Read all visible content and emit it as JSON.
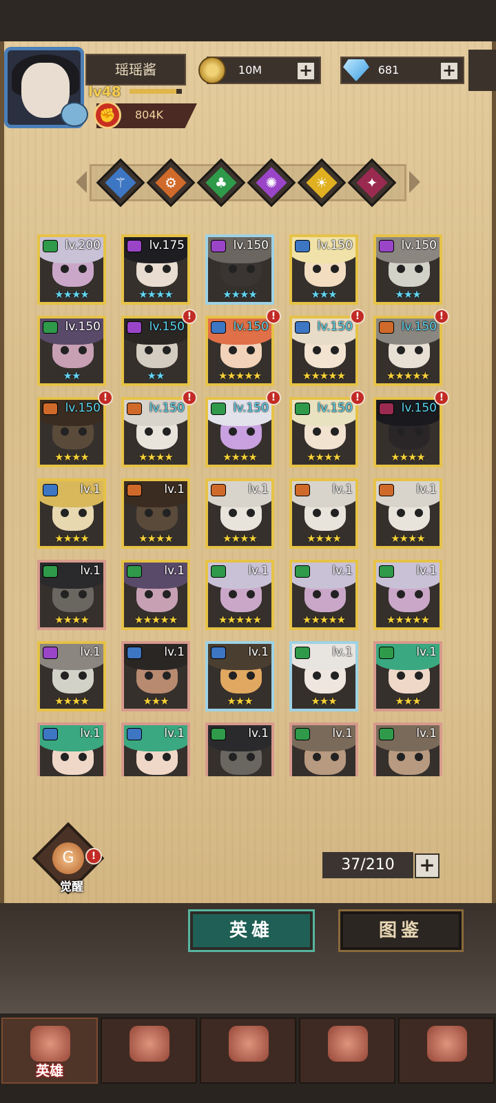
{
  "player": {
    "name": "瑶瑶酱",
    "level": "lv48",
    "xp_fraction": 0.9,
    "power": "804K"
  },
  "resources": {
    "gold": "10M",
    "gems": "681"
  },
  "factions": [
    {
      "icon": "guardian-faction-icon",
      "color": "#3d76c2"
    },
    {
      "icon": "gear-faction-icon",
      "color": "#d06a2a"
    },
    {
      "icon": "clover-faction-icon",
      "color": "#2f9a4a"
    },
    {
      "icon": "arcane-faction-icon",
      "color": "#9a45c8"
    },
    {
      "icon": "sun-faction-icon",
      "color": "#e0b020"
    },
    {
      "icon": "demon-faction-icon",
      "color": "#9a2a50"
    }
  ],
  "heroes": [
    {
      "lv": "lv.200",
      "stars": "★★★★",
      "star": "sky",
      "frame": "gold",
      "cls": "#2f9a4a",
      "hair": "#c9c2d6",
      "skin": "#caa7c8",
      "alert": false,
      "cyan": false
    },
    {
      "lv": "lv.175",
      "stars": "★★★★",
      "star": "sky",
      "frame": "gold",
      "cls": "#9a45c8",
      "hair": "#1e1e22",
      "skin": "#e8ddd0",
      "alert": false,
      "cyan": false
    },
    {
      "lv": "lv.150",
      "stars": "★★★★",
      "star": "sky",
      "frame": "blue",
      "cls": "#9a45c8",
      "hair": "#6b6660",
      "skin": "#3a3432",
      "alert": false,
      "cyan": false
    },
    {
      "lv": "lv.150",
      "stars": "★★★",
      "star": "sky",
      "frame": "gold",
      "cls": "#3d76c2",
      "hair": "#f0e2a8",
      "skin": "#f2ddc0",
      "alert": false,
      "cyan": false
    },
    {
      "lv": "lv.150",
      "stars": "★★★",
      "star": "sky",
      "frame": "gold",
      "cls": "#9a45c8",
      "hair": "#8c8680",
      "skin": "#d2d2c8",
      "alert": false,
      "cyan": false
    },
    {
      "lv": "lv.150",
      "stars": "★★",
      "star": "sky",
      "frame": "gold",
      "cls": "#2f9a4a",
      "hair": "#5a4a6a",
      "skin": "#c7a0b4",
      "alert": false,
      "cyan": false
    },
    {
      "lv": "lv.150",
      "stars": "★★",
      "star": "sky",
      "frame": "gold",
      "cls": "#9a45c8",
      "hair": "#2a2624",
      "skin": "#d4ccc0",
      "alert": true,
      "cyan": true
    },
    {
      "lv": "lv.150",
      "stars": "★★★★★",
      "star": "gold",
      "frame": "gold",
      "cls": "#3d76c2",
      "hair": "#e07048",
      "skin": "#f2d2b8",
      "alert": true,
      "cyan": true
    },
    {
      "lv": "lv.150",
      "stars": "★★★★★",
      "star": "gold",
      "frame": "gold",
      "cls": "#3d76c2",
      "hair": "#e6dcc8",
      "skin": "#f2e4d0",
      "alert": true,
      "cyan": true
    },
    {
      "lv": "lv.150",
      "stars": "★★★★★",
      "star": "gold",
      "frame": "gold",
      "cls": "#d06a2a",
      "hair": "#8a8680",
      "skin": "#e8e0d4",
      "alert": true,
      "cyan": true
    },
    {
      "lv": "lv.150",
      "stars": "★★★★",
      "star": "gold",
      "frame": "gold",
      "cls": "#d06a2a",
      "hair": "#3a2c20",
      "skin": "#5a4a3a",
      "alert": true,
      "cyan": true
    },
    {
      "lv": "lv.150",
      "stars": "★★★★",
      "star": "gold",
      "frame": "gold",
      "cls": "#d06a2a",
      "hair": "#d8d4cc",
      "skin": "#e8e4dc",
      "alert": true,
      "cyan": true
    },
    {
      "lv": "lv.150",
      "stars": "★★★★",
      "star": "gold",
      "frame": "gold",
      "cls": "#2f9a4a",
      "hair": "#e2e2ea",
      "skin": "#c9a0e0",
      "alert": true,
      "cyan": true
    },
    {
      "lv": "lv.150",
      "stars": "★★★★",
      "star": "gold",
      "frame": "gold",
      "cls": "#2f9a4a",
      "hair": "#e8e2c0",
      "skin": "#f2e2d0",
      "alert": true,
      "cyan": true
    },
    {
      "lv": "lv.150",
      "stars": "★★★★",
      "star": "gold",
      "frame": "gold",
      "cls": "#9a2a50",
      "hair": "#1a1a1e",
      "skin": "#2a2628",
      "alert": true,
      "cyan": true
    },
    {
      "lv": "lv.1",
      "stars": "★★★★",
      "star": "gold",
      "frame": "gold",
      "cls": "#3d76c2",
      "hair": "#d8b85a",
      "skin": "#e8d8b0",
      "alert": false,
      "cyan": false
    },
    {
      "lv": "lv.1",
      "stars": "★★★★",
      "star": "gold",
      "frame": "gold",
      "cls": "#d06a2a",
      "hair": "#3a2c20",
      "skin": "#5a4a3a",
      "alert": false,
      "cyan": false
    },
    {
      "lv": "lv.1",
      "stars": "★★★★",
      "star": "gold",
      "frame": "gold",
      "cls": "#d06a2a",
      "hair": "#d8d4cc",
      "skin": "#e8e4dc",
      "alert": false,
      "cyan": false
    },
    {
      "lv": "lv.1",
      "stars": "★★★★",
      "star": "gold",
      "frame": "gold",
      "cls": "#d06a2a",
      "hair": "#d8d4cc",
      "skin": "#e8e4dc",
      "alert": false,
      "cyan": false
    },
    {
      "lv": "lv.1",
      "stars": "★★★★",
      "star": "gold",
      "frame": "gold",
      "cls": "#d06a2a",
      "hair": "#d8d4cc",
      "skin": "#e8e4dc",
      "alert": false,
      "cyan": false
    },
    {
      "lv": "lv.1",
      "stars": "★★★★",
      "star": "gold",
      "frame": "pink",
      "cls": "#2f9a4a",
      "hair": "#2a2a2c",
      "skin": "#6a6660",
      "alert": false,
      "cyan": false
    },
    {
      "lv": "lv.1",
      "stars": "★★★★★",
      "star": "gold",
      "frame": "gold",
      "cls": "#2f9a4a",
      "hair": "#5a4a6a",
      "skin": "#c7a0b4",
      "alert": false,
      "cyan": false
    },
    {
      "lv": "lv.1",
      "stars": "★★★★★",
      "star": "gold",
      "frame": "gold",
      "cls": "#2f9a4a",
      "hair": "#c9c2d6",
      "skin": "#caa7c8",
      "alert": false,
      "cyan": false
    },
    {
      "lv": "lv.1",
      "stars": "★★★★★",
      "star": "gold",
      "frame": "gold",
      "cls": "#2f9a4a",
      "hair": "#c9c2d6",
      "skin": "#caa7c8",
      "alert": false,
      "cyan": false
    },
    {
      "lv": "lv.1",
      "stars": "★★★★★",
      "star": "gold",
      "frame": "gold",
      "cls": "#2f9a4a",
      "hair": "#c9c2d6",
      "skin": "#caa7c8",
      "alert": false,
      "cyan": false
    },
    {
      "lv": "lv.1",
      "stars": "★★★★",
      "star": "gold",
      "frame": "gold",
      "cls": "#9a45c8",
      "hair": "#8c8680",
      "skin": "#d2d2c8",
      "alert": false,
      "cyan": false
    },
    {
      "lv": "lv.1",
      "stars": "★★★",
      "star": "gold",
      "frame": "pink",
      "cls": "#3d76c2",
      "hair": "#2a2624",
      "skin": "#b88a70",
      "alert": false,
      "cyan": false
    },
    {
      "lv": "lv.1",
      "stars": "★★★",
      "star": "gold",
      "frame": "blue",
      "cls": "#3d76c2",
      "hair": "#4a3e30",
      "skin": "#e0a860",
      "alert": false,
      "cyan": false
    },
    {
      "lv": "lv.1",
      "stars": "★★★",
      "star": "gold",
      "frame": "blue",
      "cls": "#2f9a4a",
      "hair": "#e8e4e0",
      "skin": "#efe6e0",
      "alert": false,
      "cyan": false
    },
    {
      "lv": "lv.1",
      "stars": "★★★",
      "star": "gold",
      "frame": "pink",
      "cls": "#2f9a4a",
      "hair": "#3aa880",
      "skin": "#f0d8c8",
      "alert": false,
      "cyan": false
    },
    {
      "lv": "lv.1",
      "stars": "",
      "star": "gold",
      "frame": "pink",
      "cls": "#3d76c2",
      "hair": "#3aa880",
      "skin": "#f0d8c8",
      "alert": false,
      "cyan": false
    },
    {
      "lv": "lv.1",
      "stars": "",
      "star": "gold",
      "frame": "pink",
      "cls": "#3d76c2",
      "hair": "#3aa880",
      "skin": "#f0d8c8",
      "alert": false,
      "cyan": false
    },
    {
      "lv": "lv.1",
      "stars": "",
      "star": "gold",
      "frame": "pink",
      "cls": "#2f9a4a",
      "hair": "#2a2a2c",
      "skin": "#6a6660",
      "alert": false,
      "cyan": false
    },
    {
      "lv": "lv.1",
      "stars": "",
      "star": "gold",
      "frame": "pink",
      "cls": "#2f9a4a",
      "hair": "#7a6a5a",
      "skin": "#b89a80",
      "alert": false,
      "cyan": false
    },
    {
      "lv": "lv.1",
      "stars": "",
      "star": "gold",
      "frame": "pink",
      "cls": "#2f9a4a",
      "hair": "#7a6a5a",
      "skin": "#b89a80",
      "alert": false,
      "cyan": false
    }
  ],
  "awaken": {
    "label": "觉醒",
    "alert": "!"
  },
  "hero_count": "37/210",
  "tabs": {
    "heroes": "英雄",
    "codex": "图鉴"
  },
  "nav": [
    {
      "label": "英雄",
      "icon": "helmet-icon",
      "active": true
    },
    {
      "label": "",
      "icon": "ship-flag-icon",
      "active": false
    },
    {
      "label": "",
      "icon": "crossed-swords-icon",
      "active": false
    },
    {
      "label": "",
      "icon": "castle-tower-icon",
      "active": false
    },
    {
      "label": "",
      "icon": "guild-crest-icon",
      "active": false
    }
  ],
  "alert_mark": "!"
}
